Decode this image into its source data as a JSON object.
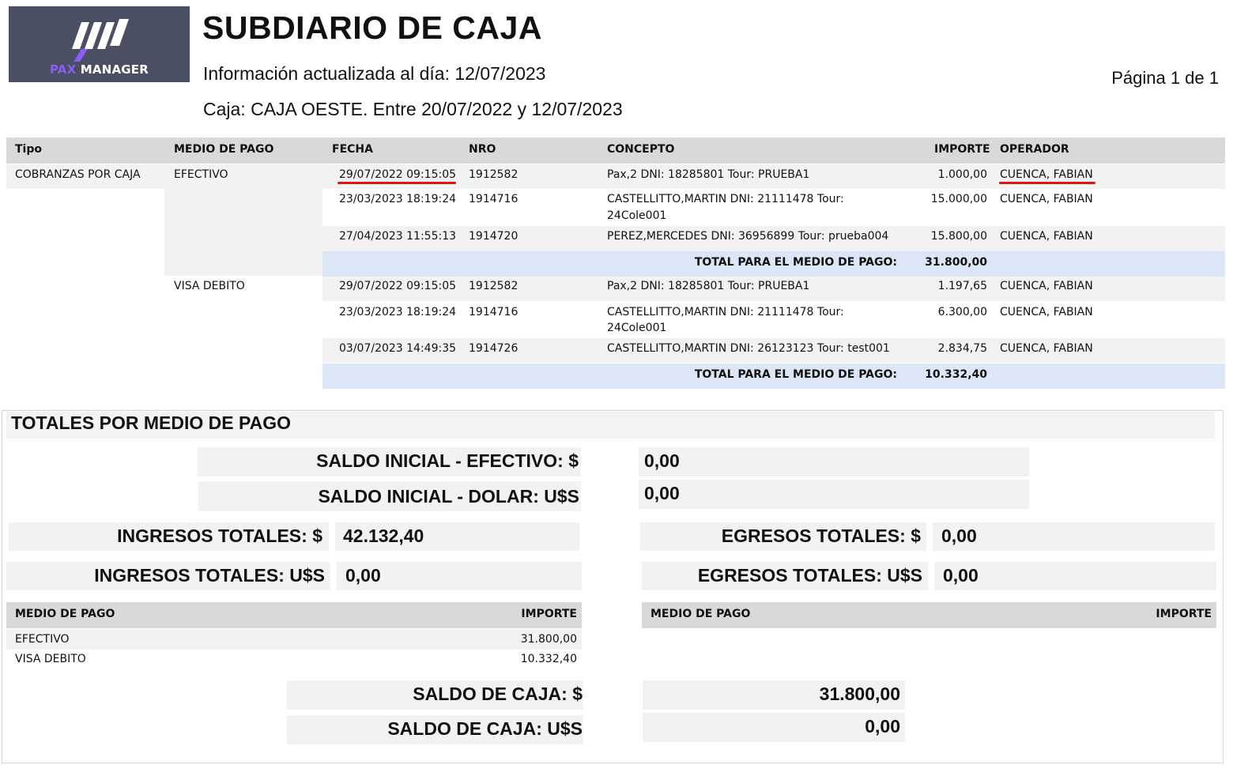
{
  "header": {
    "logo_text_accent": "PAX",
    "logo_text_main": "MANAGER",
    "title": "SUBDIARIO DE CAJA",
    "updated": "Información actualizada al día: 12/07/2023",
    "caja_line": "Caja: CAJA OESTE. Entre 20/07/2022 y 12/07/2023",
    "page": "Página 1 de 1"
  },
  "colors": {
    "logo_bg": "#4b4f63",
    "logo_accent": "#8b5cf6",
    "header_gray": "#d9d9d9",
    "total_band": "#dbe7f7",
    "annotation_red": "#e01414"
  },
  "table": {
    "columns": [
      "Tipo",
      "MEDIO DE PAGO",
      "FECHA",
      "NRO",
      "CONCEPTO",
      "IMPORTE",
      "OPERADOR"
    ],
    "tipo": "COBRANZAS POR CAJA",
    "groups": [
      {
        "medio": "EFECTIVO",
        "rows": [
          {
            "fecha": "29/07/2022 09:15:05",
            "nro": "1912582",
            "concepto": [
              "Pax,2 DNI: 18285801 Tour: PRUEBA1"
            ],
            "importe": "1.000,00",
            "operador": "CUENCA, FABIAN"
          },
          {
            "fecha": "23/03/2023 18:19:24",
            "nro": "1914716",
            "concepto": [
              "CASTELLITTO,MARTIN DNI: 21111478 Tour:",
              "24Cole001"
            ],
            "importe": "15.000,00",
            "operador": "CUENCA, FABIAN"
          },
          {
            "fecha": "27/04/2023 11:55:13",
            "nro": "1914720",
            "concepto": [
              "PEREZ,MERCEDES DNI: 36956899 Tour: prueba004"
            ],
            "importe": "15.800,00",
            "operador": "CUENCA, FABIAN"
          }
        ],
        "total_label": "TOTAL PARA EL MEDIO DE PAGO:",
        "total": "31.800,00"
      },
      {
        "medio": "VISA DEBITO",
        "rows": [
          {
            "fecha": "29/07/2022 09:15:05",
            "nro": "1912582",
            "concepto": [
              "Pax,2 DNI: 18285801 Tour: PRUEBA1"
            ],
            "importe": "1.197,65",
            "operador": "CUENCA, FABIAN"
          },
          {
            "fecha": "23/03/2023 18:19:24",
            "nro": "1914716",
            "concepto": [
              "CASTELLITTO,MARTIN DNI: 21111478 Tour:",
              "24Cole001"
            ],
            "importe": "6.300,00",
            "operador": "CUENCA, FABIAN"
          },
          {
            "fecha": "03/07/2023 14:49:35",
            "nro": "1914726",
            "concepto": [
              "CASTELLITTO,MARTIN DNI: 26123123 Tour: test001"
            ],
            "importe": "2.834,75",
            "operador": "CUENCA, FABIAN"
          }
        ],
        "total_label": "TOTAL PARA EL MEDIO DE PAGO:",
        "total": "10.332,40"
      }
    ]
  },
  "summary": {
    "title": "TOTALES POR MEDIO DE PAGO",
    "saldo_inicial_efectivo_label": "SALDO INICIAL - EFECTIVO: $",
    "saldo_inicial_efectivo": "0,00",
    "saldo_inicial_dolar_label": "SALDO INICIAL - DOLAR: U$S",
    "saldo_inicial_dolar": "0,00",
    "ingresos_pesos_label": "INGRESOS TOTALES: $",
    "ingresos_pesos": "42.132,40",
    "ingresos_usd_label": "INGRESOS TOTALES: U$S",
    "ingresos_usd": "0,00",
    "egresos_pesos_label": "EGRESOS TOTALES: $",
    "egresos_pesos": "0,00",
    "egresos_usd_label": "EGRESOS TOTALES: U$S",
    "egresos_usd": "0,00",
    "left_table": {
      "col_medio": "MEDIO DE PAGO",
      "col_importe": "IMPORTE",
      "rows": [
        {
          "medio": "EFECTIVO",
          "importe": "31.800,00"
        },
        {
          "medio": "VISA DEBITO",
          "importe": "10.332,40"
        }
      ]
    },
    "right_table": {
      "col_medio": "MEDIO DE PAGO",
      "col_importe": "IMPORTE"
    },
    "saldo_caja_pesos_label": "SALDO DE CAJA: $",
    "saldo_caja_pesos": "31.800,00",
    "saldo_caja_usd_label": "SALDO DE CAJA: U$S",
    "saldo_caja_usd": "0,00"
  }
}
